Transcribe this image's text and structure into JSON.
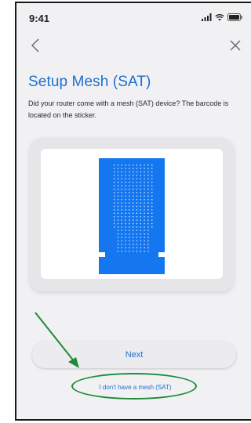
{
  "status_bar": {
    "time": "9:41",
    "icons": [
      "signal-icon",
      "wifi-icon",
      "battery-icon"
    ]
  },
  "nav": {
    "back_icon": "chevron-left-icon",
    "close_icon": "close-icon"
  },
  "page": {
    "title": "Setup Mesh (SAT)",
    "description": "Did your router come with a mesh (SAT) device? The barcode is located on the sticker."
  },
  "device_image": {
    "icon": "mesh-device-sticker-icon",
    "color": "#1477f0"
  },
  "actions": {
    "next_label": "Next",
    "no_mesh_label": "I don't have a mesh (SAT)"
  },
  "annotation": {
    "color": "#1e8a3a"
  },
  "colors": {
    "accent": "#1f6fcf",
    "background": "#f1f1f3"
  }
}
